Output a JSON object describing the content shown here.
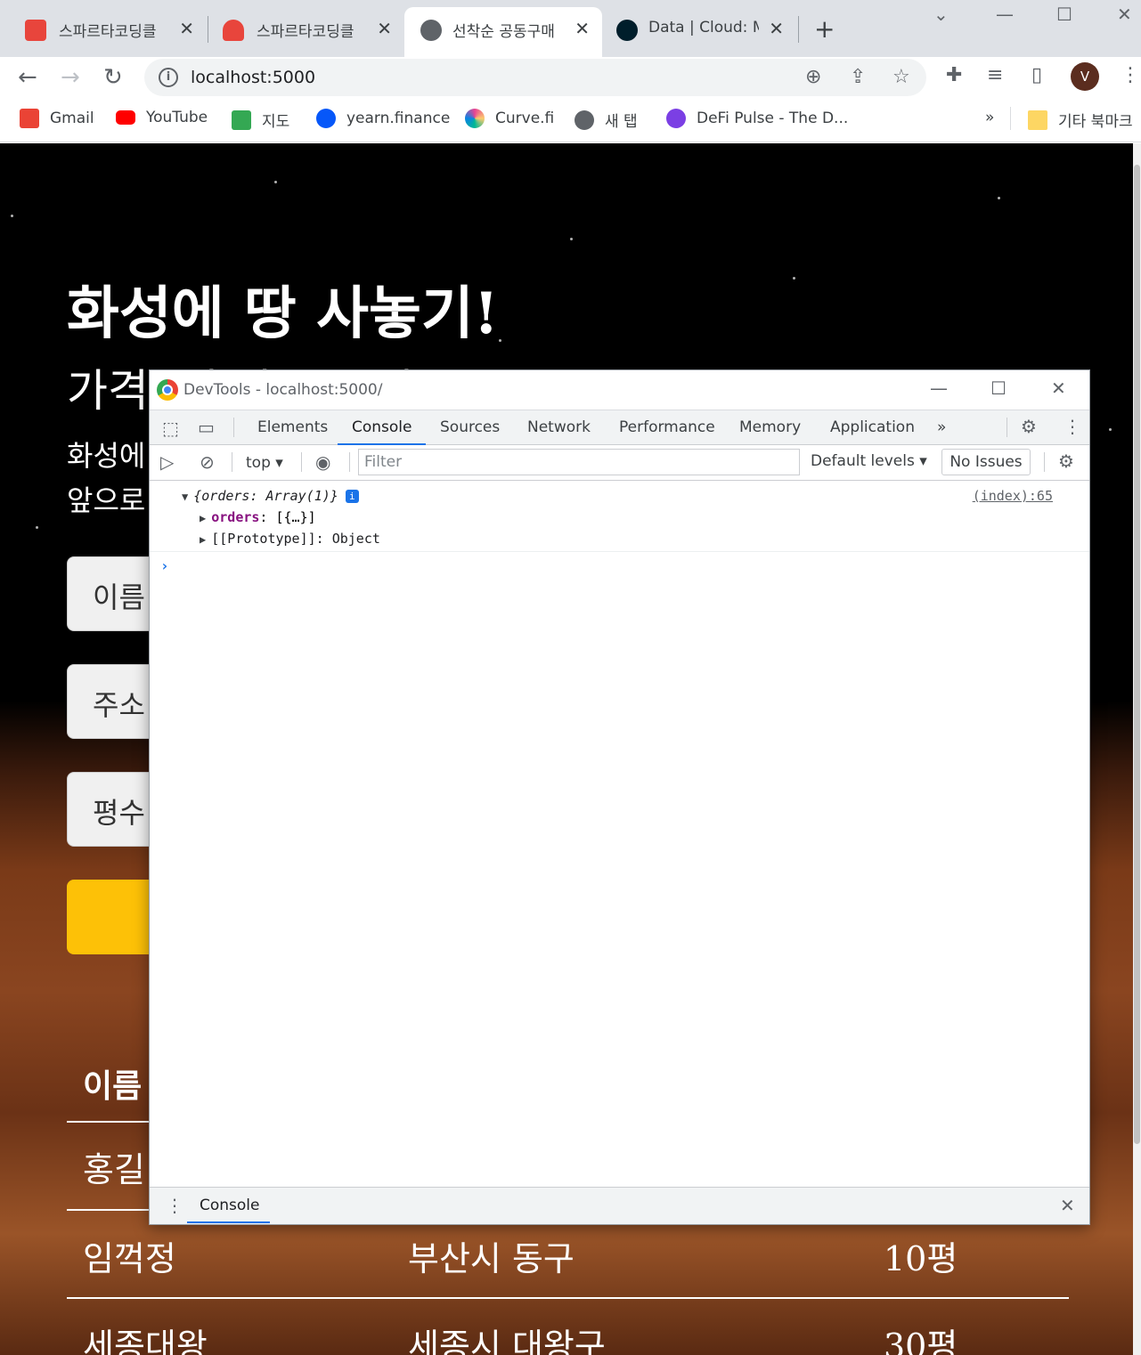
{
  "browser": {
    "tabs": [
      {
        "title": "스파르타코딩클",
        "color": "#e8453c"
      },
      {
        "title": "스파르타코딩클",
        "color": "#e8453c"
      },
      {
        "title": "선착순 공동구매",
        "color": "#5f6368"
      },
      {
        "title": "Data | Cloud: M",
        "color": "#13aa52"
      }
    ],
    "url": "localhost:5000",
    "avatar_letter": "V",
    "bookmarks": [
      {
        "label": "Gmail",
        "color": "#ea4335"
      },
      {
        "label": "YouTube",
        "color": "#ff0000"
      },
      {
        "label": "지도",
        "color": "#34a853"
      },
      {
        "label": "yearn.finance",
        "color": "#0657f9"
      },
      {
        "label": "Curve.fi",
        "color": "#e84393"
      },
      {
        "label": "새 탭",
        "color": "#5f6368"
      },
      {
        "label": "DeFi Pulse - The D...",
        "color": "#7b3fe4"
      }
    ],
    "bookmarks_overflow": "»",
    "other_bookmarks": "기타 북마크"
  },
  "page": {
    "title": "화성에 땅 사놓기!",
    "price": "가격: 평 당 500원",
    "desc_line1": "화성에",
    "desc_line2": "앞으로",
    "fields": [
      "이름",
      "주소",
      "평수"
    ],
    "table_headers": [
      "이름"
    ],
    "rows": [
      {
        "name": "홍길",
        "address": "",
        "size": ""
      },
      {
        "name": "임꺽정",
        "address": "부산시 동구",
        "size": "10평"
      },
      {
        "name": "세종대왕",
        "address": "세종시 대왕구",
        "size": "30평"
      }
    ]
  },
  "devtools": {
    "window_title": "DevTools - localhost:5000/",
    "tabs": [
      "Elements",
      "Console",
      "Sources",
      "Network",
      "Performance",
      "Memory",
      "Application"
    ],
    "more_tabs": "»",
    "context": "top",
    "filter_placeholder": "Filter",
    "levels": "Default levels",
    "issues": "No Issues",
    "log": {
      "summary": "{orders: Array(1)}",
      "source": "(index):65",
      "prop_key": "orders",
      "prop_value": "[{…}]",
      "proto": "[[Prototype]]: Object"
    },
    "drawer_tab": "Console"
  }
}
